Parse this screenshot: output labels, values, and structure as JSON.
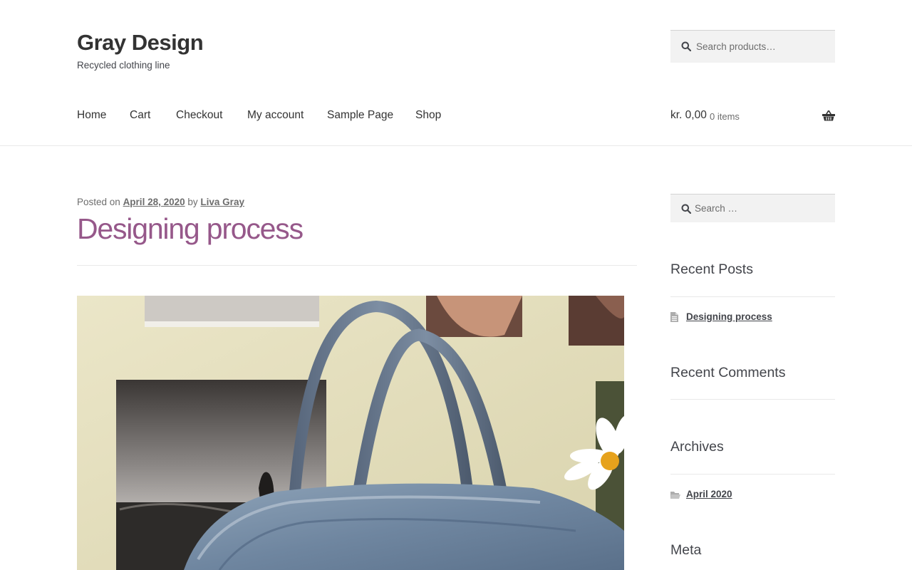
{
  "site": {
    "title": "Gray Design",
    "description": "Recycled clothing line"
  },
  "header_search": {
    "placeholder": "Search products…"
  },
  "nav": {
    "items": [
      "Home",
      "Cart",
      "Checkout",
      "My account",
      "Sample Page",
      "Shop"
    ]
  },
  "cart": {
    "amount": "kr. 0,00",
    "count": "0 items"
  },
  "post": {
    "posted_on_label": "Posted on",
    "date": "April 28, 2020",
    "by_label": "by",
    "author": "Liva Gray",
    "title": "Designing process"
  },
  "sidebar": {
    "search_placeholder": "Search …",
    "recent_posts": {
      "title": "Recent Posts",
      "items": [
        "Designing process"
      ]
    },
    "recent_comments": {
      "title": "Recent Comments"
    },
    "archives": {
      "title": "Archives",
      "items": [
        "April 2020"
      ]
    },
    "meta": {
      "title": "Meta"
    }
  },
  "colors": {
    "accent": "#96588a",
    "text": "#43454b",
    "heading": "#333333",
    "muted": "#6d6d6d",
    "input_bg": "#f2f2f2",
    "divider": "#e9e9e9"
  },
  "icons": {
    "search": "search-icon",
    "basket": "basket-icon",
    "post": "document-icon",
    "folder": "folder-icon"
  }
}
